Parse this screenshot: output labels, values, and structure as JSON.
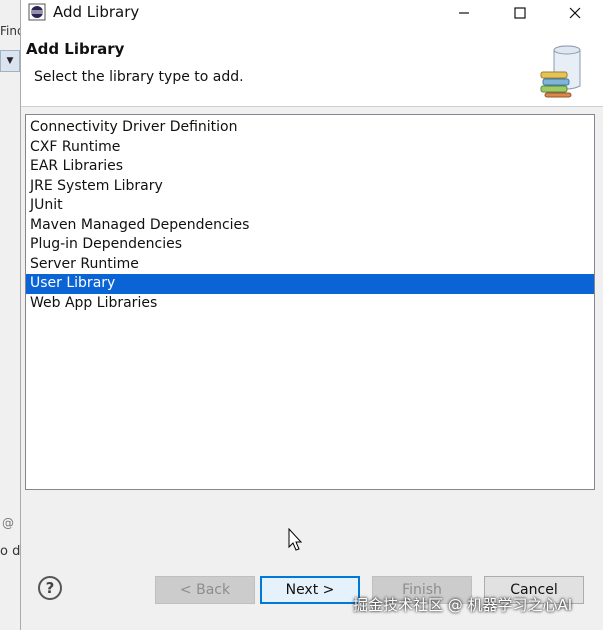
{
  "background_app": {
    "fragment_top": "Find",
    "fragment_mid": "@",
    "fragment_bottom": "o d"
  },
  "window": {
    "title": "Add Library",
    "minimize_glyph": "—",
    "maximize_glyph": "☐",
    "close_glyph": "✕"
  },
  "header": {
    "title": "Add Library",
    "subtitle": "Select the library type to add."
  },
  "library_types": [
    "Connectivity Driver Definition",
    "CXF Runtime",
    "EAR Libraries",
    "JRE System Library",
    "JUnit",
    "Maven Managed Dependencies",
    "Plug-in Dependencies",
    "Server Runtime",
    "User Library",
    "Web App Libraries"
  ],
  "selected_index": 8,
  "buttons": {
    "help": "?",
    "back": "< Back",
    "next": "Next >",
    "finish": "Finish",
    "cancel": "Cancel"
  },
  "watermark": "掘金技术社区 @ 机器学习之心AI",
  "colors": {
    "selection": "#0a64d6",
    "default_button_border": "#0078d7"
  }
}
